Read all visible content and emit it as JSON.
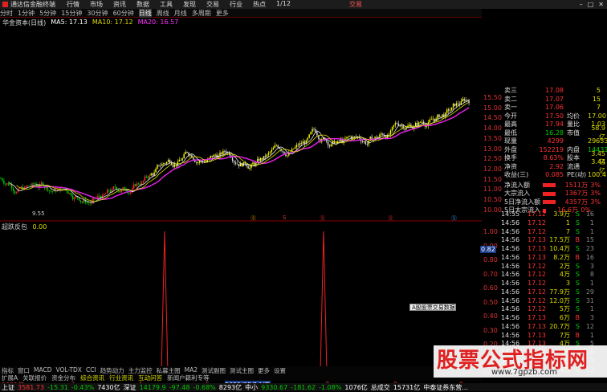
{
  "titlebar": {
    "app_title": "通达信金融终端",
    "menus": [
      "行情",
      "市场",
      "资讯",
      "数据",
      "工具",
      "发现",
      "交易",
      "行业",
      "热点",
      "1/12"
    ],
    "trade_label": "交易"
  },
  "periods": [
    "分时",
    "1分钟",
    "5分钟",
    "15分钟",
    "30分钟",
    "60分钟",
    "日线",
    "周线",
    "月线",
    "多周期",
    "更多"
  ],
  "selected_period": "日线",
  "stockline": {
    "name": "华金资本(日线)",
    "ma5": "MA5: 17.13",
    "ma10": "MA10: 17.12",
    "ma20": "MA20: 16.57"
  },
  "chart_data": {
    "type": "candlestick",
    "price_ticks": [
      "15.50",
      "15.00",
      "14.50",
      "14.00",
      "13.50",
      "13.00",
      "12.50",
      "12.00",
      "11.50",
      "11.00",
      "10.50",
      "10.00"
    ],
    "low_label": "9.55",
    "markers": [
      "Ⓢ",
      "S",
      "Ⓢ",
      "Ⓢ",
      "Ⓢ"
    ],
    "indicator_title": "超跌反包",
    "indicator_value": "0.00",
    "indicator_ticks": [
      "1.00",
      "0.90",
      "0.80",
      "0.70",
      "0.60",
      "0.50",
      "0.40",
      "0.30",
      "0.20",
      "0.10",
      "0.00"
    ],
    "indicator_cursor": "0.82",
    "date_labels": [
      "2021年",
      "3",
      "4",
      "5",
      "2021/05/14/五",
      "7",
      "8",
      "9"
    ]
  },
  "tooltip": "A股股票交易数据",
  "panel": {
    "asks": [
      {
        "k": "卖三",
        "v": "17.08",
        "q": "5"
      },
      {
        "k": "卖二",
        "v": "17.07",
        "q": "15"
      },
      {
        "k": "卖一",
        "v": "17.06",
        "q": "7"
      }
    ],
    "rows": [
      {
        "k": "今开",
        "v": "17.50",
        "k2": "均价",
        "v2": "17.00"
      },
      {
        "k": "最高",
        "v": "17.94",
        "k2": "量比",
        "v2": "1.03"
      },
      {
        "k": "最低",
        "v": "16.28",
        "k2": "市值",
        "v2": "58.9亿"
      },
      {
        "k": "现量",
        "v": "4299",
        "k2": "",
        "v2": "296532"
      },
      {
        "k": "外盘",
        "v": "152219",
        "k2": "内盘",
        "v2": "144313"
      },
      {
        "k": "换手",
        "v": "8.63%",
        "k2": "股本",
        "v2": "3.45亿"
      },
      {
        "k": "净资",
        "v": "2.92",
        "k2": "流通",
        "v2": "3.44亿"
      },
      {
        "k": "收益(三)",
        "v": "0.085",
        "k2": "PE(动)",
        "v2": "100.4"
      }
    ],
    "flows": [
      {
        "k": "净流入额",
        "v": "1511万",
        "p": "3%"
      },
      {
        "k": "大宗流入",
        "v": "1367万",
        "p": "3%"
      },
      {
        "k": "5日净流入额",
        "v": "4357万",
        "p": "3%"
      },
      {
        "k": "5日大宗流入",
        "v": "16.6万",
        "p": "0%"
      }
    ]
  },
  "ticks": [
    {
      "t": "14:55",
      "p": "17.12",
      "v": "3.9万",
      "f": "S",
      "x": "16"
    },
    {
      "t": "14:56",
      "p": "17.12",
      "v": "1",
      "f": "S",
      "x": "1"
    },
    {
      "t": "14:56",
      "p": "17.12",
      "v": "7",
      "f": "S",
      "x": "1"
    },
    {
      "t": "14:56",
      "p": "17.13",
      "v": "17.5万",
      "f": "B",
      "x": "15"
    },
    {
      "t": "14:56",
      "p": "17.13",
      "v": "10.4万",
      "f": "S",
      "x": "23"
    },
    {
      "t": "14:56",
      "p": "17.13",
      "v": "8.2万",
      "f": "B",
      "x": "16"
    },
    {
      "t": "14:56",
      "p": "17.12",
      "v": "2万",
      "f": "S",
      "x": "3"
    },
    {
      "t": "14:56",
      "p": "17.12",
      "v": "4万",
      "f": "S",
      "x": "8"
    },
    {
      "t": "14:56",
      "p": "17.12",
      "v": "3",
      "f": "S",
      "x": "1"
    },
    {
      "t": "14:56",
      "p": "17.12",
      "v": "77.9万",
      "f": "S",
      "x": "29"
    },
    {
      "t": "14:56",
      "p": "17.12",
      "v": "12.0万",
      "f": "S",
      "x": "31"
    },
    {
      "t": "14:56",
      "p": "17.12",
      "v": "5万",
      "f": "S",
      "x": "1"
    },
    {
      "t": "14:56",
      "p": "17.13",
      "v": "6万",
      "f": "B",
      "x": "3"
    },
    {
      "t": "14:56",
      "p": "17.13",
      "v": "20.7万",
      "f": "S",
      "x": "12"
    },
    {
      "t": "14:56",
      "p": "17.13",
      "v": "7万",
      "f": "B",
      "x": "1"
    },
    {
      "t": "14:56",
      "p": "17.13",
      "v": "4万",
      "f": "S",
      "x": "5"
    },
    {
      "t": "14:56",
      "p": "17.13",
      "v": "8万",
      "f": "B",
      "x": "16"
    },
    {
      "t": "14:56",
      "p": "17.13",
      "v": "2万",
      "f": "S",
      "x": "3"
    },
    {
      "t": "15:00",
      "p": "17.12",
      "v": "4万",
      "f": "S",
      "x": "12"
    }
  ],
  "bottomtabs": [
    "指标",
    "窗口",
    "MACD",
    "VOL-TDX",
    "CCI",
    "趋势动力",
    "主力监控",
    "私募主图",
    "MA2",
    "测试副图",
    "测试主图",
    "更多",
    "设置"
  ],
  "bottomtabs2": [
    "扩展A",
    "关联报价",
    "资金分布",
    "综合资讯",
    "行业资讯",
    "互动问答",
    "新闻户籍利专等"
  ],
  "statusbar": [
    {
      "text": "上证",
      "cls": "white"
    },
    {
      "text": "3581.73",
      "cls": "red"
    },
    {
      "text": "-15.31",
      "cls": "green"
    },
    {
      "text": "-0.43%",
      "cls": "green"
    },
    {
      "text": "7430亿",
      "cls": "white"
    },
    {
      "text": "深证",
      "cls": "white"
    },
    {
      "text": "14179.9",
      "cls": "green"
    },
    {
      "text": "-97.48",
      "cls": "green"
    },
    {
      "text": "-0.68%",
      "cls": "green"
    },
    {
      "text": "8293亿",
      "cls": "white"
    },
    {
      "text": "中小",
      "cls": "white"
    },
    {
      "text": "9330.67",
      "cls": "green"
    },
    {
      "text": "-181.62",
      "cls": "green"
    },
    {
      "text": "-1.08%",
      "cls": "green"
    },
    {
      "text": "1076亿",
      "cls": "white"
    },
    {
      "text": "总成交",
      "cls": "white"
    },
    {
      "text": "15731亿",
      "cls": "white"
    },
    {
      "text": "中泰证券东营...",
      "cls": "white"
    }
  ],
  "watermark": {
    "text": "股票公式指标网",
    "url": "www.7gpzb.com"
  }
}
